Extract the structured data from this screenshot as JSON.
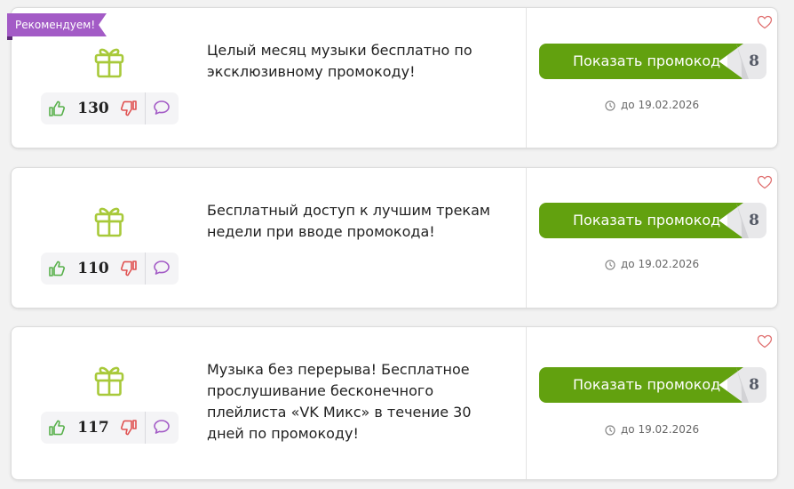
{
  "badge": {
    "label": "Рекомендуем!"
  },
  "offers": [
    {
      "text": "Целый месяц музыки бесплатно по эксклюзивному промокоду!",
      "votes": "130",
      "button_label": "Показать промокод",
      "code_hint": "8",
      "expiry": "до 19.02.2026"
    },
    {
      "text": "Бесплатный доступ к лучшим трекам недели при вводе промокода!",
      "votes": "110",
      "button_label": "Показать промокод",
      "code_hint": "8",
      "expiry": "до 19.02.2026"
    },
    {
      "text": "Музыка без перерыва! Бесплатное прослушивание бесконечного плейлиста «VK Микс» в течение 30 дней по промокоду!",
      "votes": "117",
      "button_label": "Показать промокод",
      "code_hint": "8",
      "expiry": "до 19.02.2026"
    }
  ],
  "icons": {
    "gift": "gift-icon",
    "like": "thumbs-up-icon",
    "dislike": "thumbs-down-icon",
    "comment": "comment-icon",
    "clock": "clock-icon",
    "favorite": "heart-icon"
  },
  "colors": {
    "button": "#62a10f",
    "badge": "#a35bc6",
    "gift": "#a8c93a",
    "like": "#58b04b",
    "dislike": "#e05050",
    "comment": "#a35bc6",
    "heart": "#e07070"
  }
}
